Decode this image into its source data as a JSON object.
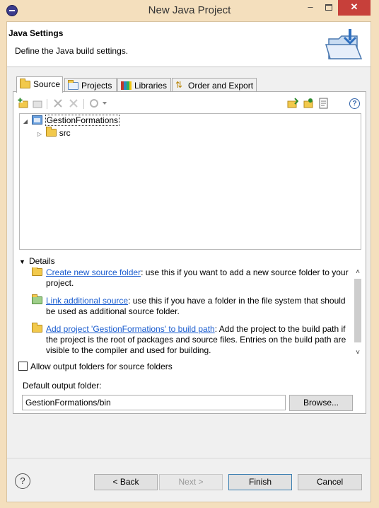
{
  "window": {
    "title": "New Java Project",
    "minimize": "–",
    "close": "✕"
  },
  "header": {
    "title": "Java Settings",
    "description": "Define the Java build settings."
  },
  "tabs": [
    {
      "label": "Source",
      "icon": "source-folder-icon",
      "active": true
    },
    {
      "label": "Projects",
      "icon": "project-icon",
      "active": false
    },
    {
      "label": "Libraries",
      "icon": "libraries-icon",
      "active": false
    },
    {
      "label": "Order and Export",
      "icon": "order-export-icon",
      "active": false
    }
  ],
  "toolbar": {
    "help": "?"
  },
  "tree": {
    "project": "GestionFormations",
    "children": [
      "src"
    ]
  },
  "details": {
    "label": "Details",
    "items": [
      {
        "link": "Create new source folder",
        "text": ": use this if you want to add a new source folder to your project."
      },
      {
        "link": "Link additional source",
        "text": ": use this if you have a folder in the file system that should be used as additional source folder."
      },
      {
        "link": "Add project 'GestionFormations' to build path",
        "text": ": Add the project to the build path if the project is the root of packages and source files. Entries on the build path are visible to the compiler and used for building."
      }
    ]
  },
  "options": {
    "allow_output_folders": "Allow output folders for source folders",
    "allow_output_folders_checked": false,
    "default_output_label": "Default output folder:",
    "default_output_value": "GestionFormations/bin",
    "browse": "Browse..."
  },
  "footer": {
    "help": "?",
    "back": "< Back",
    "next": "Next >",
    "finish": "Finish",
    "cancel": "Cancel"
  },
  "colors": {
    "title_bar": "#f4dfbd",
    "close_button": "#c7403a",
    "link": "#1a5ccf"
  }
}
